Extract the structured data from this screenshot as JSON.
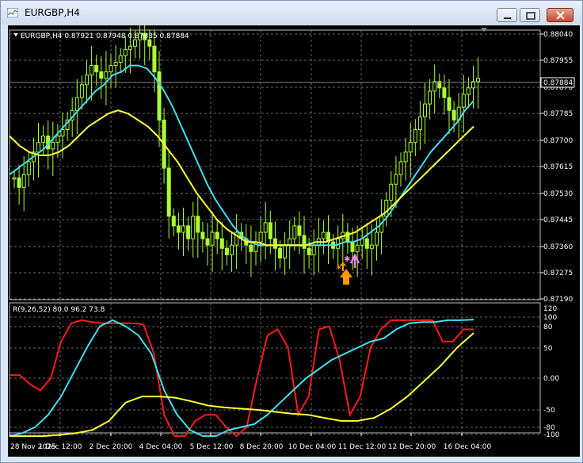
{
  "window": {
    "title": "EURGBP,H4"
  },
  "price_panel": {
    "header": "EURGBP,H4  0.87921 0.87948 0.87835 0.87884",
    "current_price_label": "0.87884",
    "y_ticks": [
      "0.88040",
      "0.87955",
      "0.87870",
      "0.87785",
      "0.87700",
      "0.87615",
      "0.87530",
      "0.87445",
      "0.87360",
      "0.87275",
      "0.87190"
    ]
  },
  "indicator_panel": {
    "header": "R(9,26,52) 80.0 96.2 73.8",
    "y_ticks": [
      "120",
      "100",
      "80",
      "50",
      "0.00",
      "-50",
      "-80",
      "-100"
    ]
  },
  "x_axis": {
    "ticks": [
      "28 Nov 2025",
      "1 Dec 12:00",
      "2 Dec 20:00",
      "4 Dec 04:00",
      "5 Dec 12:00",
      "8 Dec 20:00",
      "10 Dec 04:00",
      "11 Dec 12:00",
      "12 Dec 20:00",
      "16 Dec 04:00"
    ]
  },
  "colors": {
    "background": "#000000",
    "grid": "#8c8c8c",
    "candle": "#adff2f",
    "ma_fast": "#40e0f0",
    "ma_slow": "#ffff33",
    "rsi_fast": "#ff1a1a",
    "signal_arrow": "#ff9900",
    "signal_arrow2": "#ee82ee"
  },
  "chart_data": [
    {
      "type": "candlestick",
      "title": "EURGBP,H4",
      "ylim": [
        0.8719,
        0.8804
      ],
      "closes": [
        0.8757,
        0.8754,
        0.8758,
        0.8762,
        0.8765,
        0.8768,
        0.877,
        0.8766,
        0.8768,
        0.877,
        0.8772,
        0.8775,
        0.8778,
        0.8782,
        0.8786,
        0.8789,
        0.8792,
        0.879,
        0.8788,
        0.879,
        0.8792,
        0.8793,
        0.8795,
        0.8797,
        0.8798,
        0.88,
        0.8802,
        0.88,
        0.8798,
        0.879,
        0.8775,
        0.876,
        0.8745,
        0.8742,
        0.874,
        0.8742,
        0.8738,
        0.8745,
        0.874,
        0.8738,
        0.8736,
        0.874,
        0.8738,
        0.8735,
        0.8733,
        0.8736,
        0.874,
        0.8738,
        0.8736,
        0.8734,
        0.8737,
        0.874,
        0.8743,
        0.8738,
        0.8735,
        0.8732,
        0.8736,
        0.8738,
        0.8742,
        0.8739,
        0.8735,
        0.8733,
        0.8736,
        0.8738,
        0.874,
        0.8737,
        0.8735,
        0.8738,
        0.874,
        0.8737,
        0.8734,
        0.8736,
        0.8738,
        0.8735,
        0.8736,
        0.874,
        0.8745,
        0.875,
        0.8755,
        0.8758,
        0.8762,
        0.8765,
        0.8768,
        0.8772,
        0.8776,
        0.878,
        0.8784,
        0.8787,
        0.8785,
        0.8782,
        0.8778,
        0.8775,
        0.8779,
        0.8783,
        0.8785,
        0.8787,
        0.8788
      ],
      "series": [
        {
          "name": "ma_fast",
          "values": [
            0.8758,
            0.876,
            0.8762,
            0.8764,
            0.8766,
            0.8769,
            0.8772,
            0.8775,
            0.8778,
            0.8781,
            0.8784,
            0.8786,
            0.8789,
            0.879,
            0.8792,
            0.8792,
            0.8791,
            0.8788,
            0.8784,
            0.8779,
            0.8773,
            0.8767,
            0.8761,
            0.8755,
            0.875,
            0.8746,
            0.8742,
            0.8739,
            0.8737,
            0.8736,
            0.8736,
            0.8736,
            0.8736,
            0.8736,
            0.8736,
            0.8736,
            0.8736,
            0.8736,
            0.8736,
            0.8737,
            0.8737,
            0.8738,
            0.874,
            0.8742,
            0.8745,
            0.8749,
            0.8753,
            0.8757,
            0.8761,
            0.8765,
            0.8768,
            0.8771,
            0.8774,
            0.8778,
            0.8781
          ]
        },
        {
          "name": "ma_slow",
          "values": [
            0.877,
            0.8767,
            0.8765,
            0.8764,
            0.8764,
            0.8765,
            0.8767,
            0.877,
            0.8773,
            0.8775,
            0.8777,
            0.8778,
            0.8777,
            0.8775,
            0.8773,
            0.877,
            0.8766,
            0.8762,
            0.8757,
            0.8752,
            0.8748,
            0.8744,
            0.8741,
            0.8739,
            0.8737,
            0.8737,
            0.8736,
            0.8736,
            0.8736,
            0.8736,
            0.8736,
            0.8737,
            0.8737,
            0.8738,
            0.8739,
            0.874,
            0.8742,
            0.8744,
            0.8746,
            0.8749,
            0.8752,
            0.8755,
            0.8758,
            0.8761,
            0.8764,
            0.8767,
            0.877,
            0.8773
          ]
        }
      ]
    },
    {
      "type": "line",
      "title": "R(9,26,52) 80.0 96.2 73.8",
      "ylim": [
        -100,
        120
      ],
      "series": [
        {
          "name": "9",
          "values": [
            5,
            5,
            -10,
            -20,
            0,
            60,
            90,
            95,
            92,
            90,
            90,
            90,
            90,
            88,
            40,
            -60,
            -95,
            -95,
            -70,
            -60,
            -60,
            -80,
            -95,
            -80,
            0,
            70,
            80,
            50,
            -60,
            -30,
            80,
            85,
            30,
            -60,
            -30,
            50,
            80,
            95,
            95,
            95,
            95,
            95,
            60,
            60,
            80,
            80
          ]
        },
        {
          "name": "26",
          "values": [
            -95,
            -90,
            -80,
            -60,
            -30,
            10,
            50,
            85,
            95,
            85,
            70,
            40,
            -20,
            -60,
            -85,
            -95,
            -95,
            -85,
            -80,
            -75,
            -60,
            -40,
            -20,
            0,
            15,
            30,
            40,
            50,
            60,
            65,
            80,
            90,
            92,
            92,
            95,
            95,
            96
          ]
        },
        {
          "name": "52",
          "values": [
            -95,
            -95,
            -95,
            -93,
            -90,
            -85,
            -70,
            -40,
            -30,
            -30,
            -32,
            -38,
            -45,
            -48,
            -50,
            -52,
            -55,
            -58,
            -60,
            -65,
            -70,
            -70,
            -65,
            -50,
            -30,
            -5,
            20,
            50,
            74
          ]
        }
      ]
    }
  ]
}
